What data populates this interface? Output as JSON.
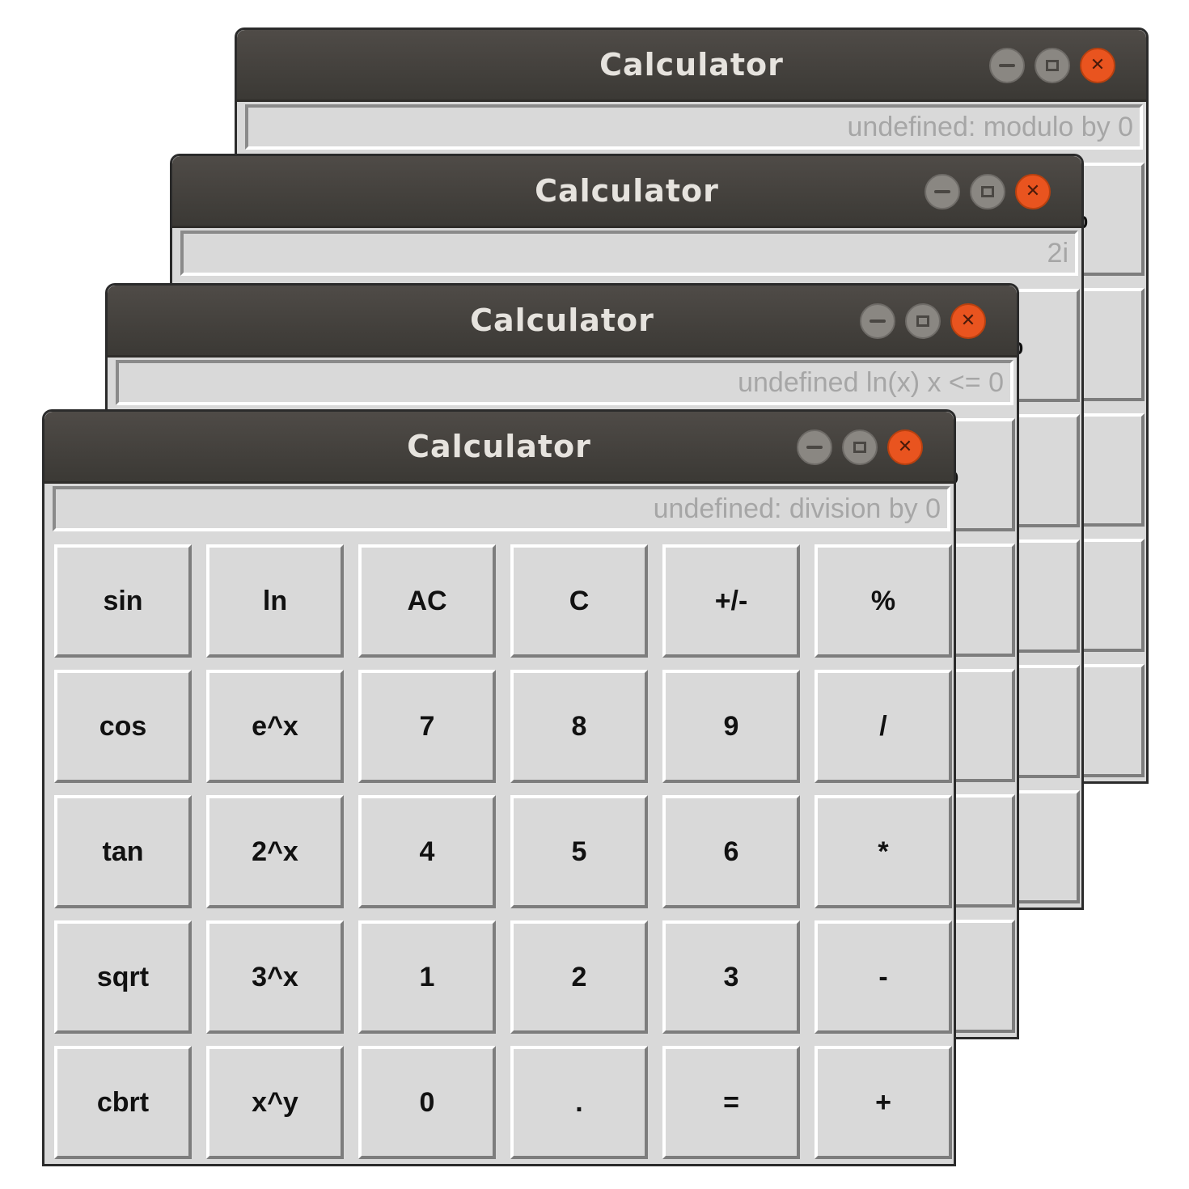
{
  "windows": [
    {
      "id": "back3",
      "title": "Calculator",
      "display": "undefined: modulo by 0"
    },
    {
      "id": "back2",
      "title": "Calculator",
      "display": "2i"
    },
    {
      "id": "back1",
      "title": "Calculator",
      "display": "undefined ln(x) x <= 0"
    },
    {
      "id": "front",
      "title": "Calculator",
      "display": "undefined: division by 0"
    }
  ],
  "keys": [
    "sin",
    "ln",
    "AC",
    "C",
    "+/-",
    "%",
    "cos",
    "e^x",
    "7",
    "8",
    "9",
    "/",
    "tan",
    "2^x",
    "4",
    "5",
    "6",
    "*",
    "sqrt",
    "3^x",
    "1",
    "2",
    "3",
    "-",
    "cbrt",
    "x^y",
    "0",
    ".",
    "=",
    "+"
  ],
  "titlebar_controls": {
    "minimize": "minimize-icon",
    "maximize": "maximize-icon",
    "close": "close-icon"
  },
  "colors": {
    "titlebar": "#3b3935",
    "close": "#e9541f",
    "body": "#d9d9d9",
    "display_text": "#a6a6a6"
  }
}
